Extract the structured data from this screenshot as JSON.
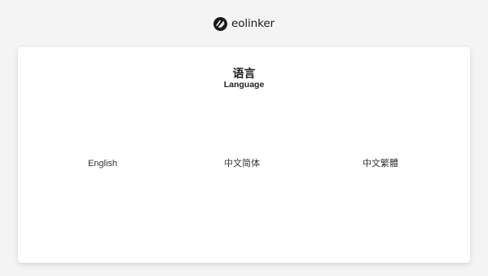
{
  "brand": {
    "name": "eolinker",
    "logo_icon": "eolinker-logo-icon"
  },
  "language_card": {
    "title": "语言",
    "subtitle": "Language",
    "options": [
      {
        "label": "English"
      },
      {
        "label": "中文简体"
      },
      {
        "label": "中文繁體"
      }
    ]
  },
  "colors": {
    "background": "#f4f4f4",
    "card": "#ffffff",
    "text": "#222222"
  }
}
